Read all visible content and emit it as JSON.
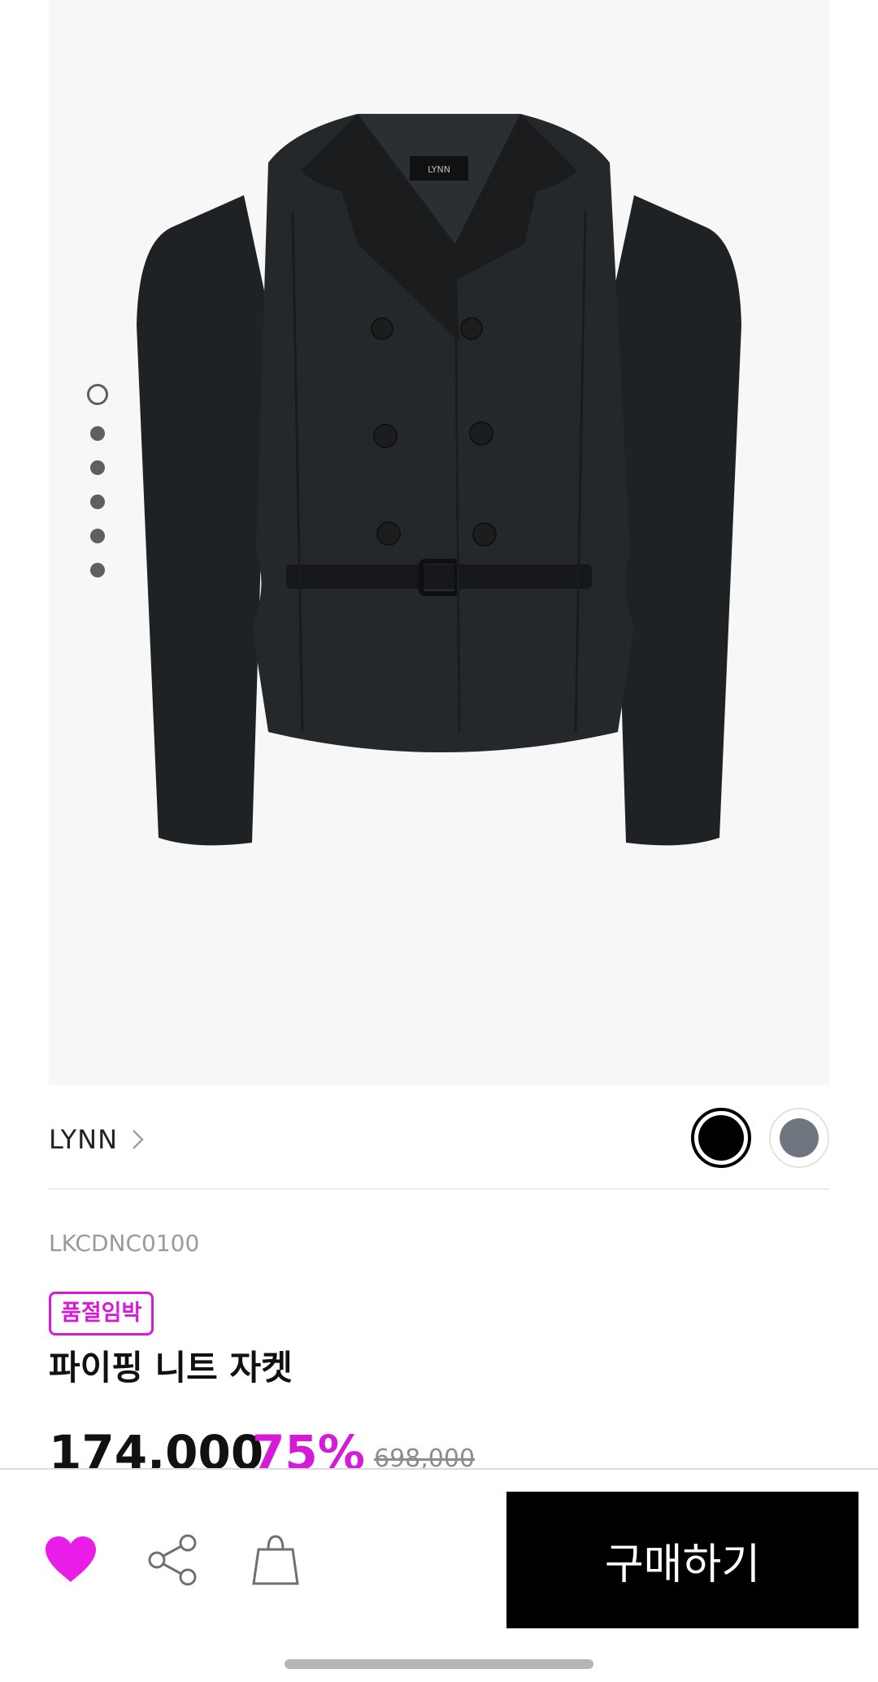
{
  "gallery": {
    "image_alt": "black double-breasted belted knit jacket",
    "label_text": "LYNN",
    "page_count": 6,
    "active_page": 1
  },
  "brand": {
    "name": "LYNN"
  },
  "colors": {
    "options": [
      {
        "name": "black",
        "hex": "#000000",
        "selected": true
      },
      {
        "name": "gray",
        "hex": "#6f7680",
        "selected": false
      }
    ],
    "accent": "#d41bd8"
  },
  "product": {
    "sku": "LKCDNC0100",
    "badge": "품절임박",
    "name": "파이핑 니트 자켓",
    "price": "174,000",
    "discount": "75%",
    "original_price": "698,000"
  },
  "actions": {
    "buy_label": "구매하기",
    "wish_icon": "heart-icon",
    "share_icon": "share-icon",
    "cart_icon": "shopping-bag-icon"
  }
}
